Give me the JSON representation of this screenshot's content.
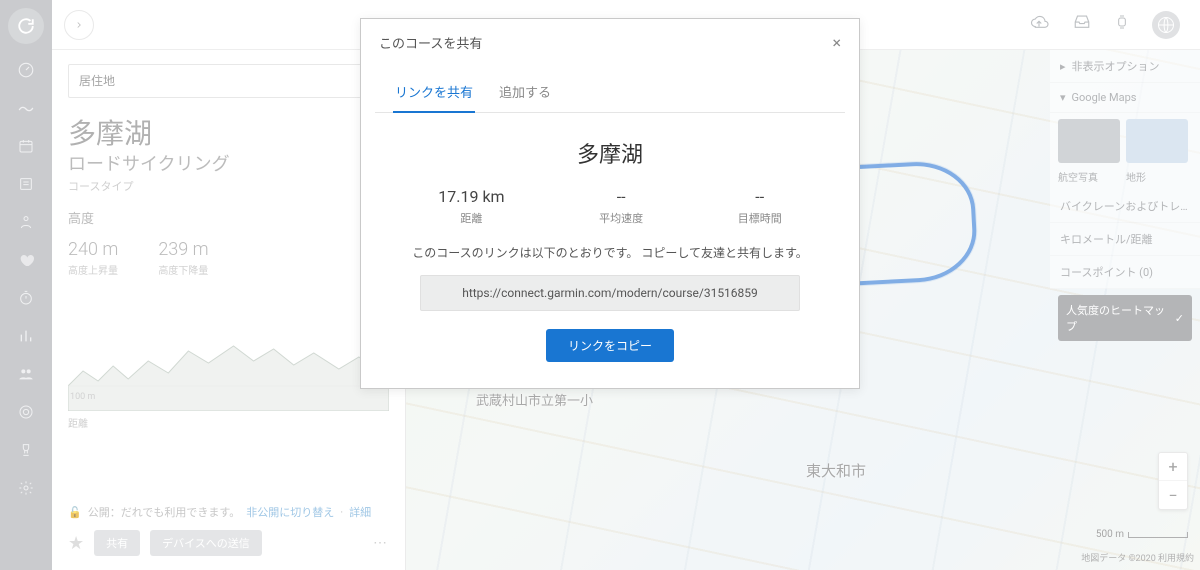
{
  "search": {
    "placeholder": "居住地"
  },
  "course": {
    "title": "多摩湖",
    "type": "ロードサイクリング",
    "type_label": "コースタイプ",
    "elev_section": "高度",
    "ascent": {
      "val": "240 m",
      "lbl": "高度上昇量"
    },
    "descent": {
      "val": "239 m",
      "lbl": "高度下降量"
    },
    "elev_span": "距離",
    "elev_y0": "100 m"
  },
  "privacy": {
    "text": "公開：だれでも利用できます。",
    "private_link": "非公開に切り替え",
    "detail_link": "詳細"
  },
  "actions": {
    "share": "共有",
    "send": "デバイスへの送信"
  },
  "map_opts": {
    "display_options": "非表示オプション",
    "google_maps": "Google Maps",
    "thumb1": "航空写真",
    "thumb2": "地形",
    "bike": "バイクレーンおよびトレ…",
    "km": "キロメートル/距離",
    "coursepoints": "コースポイント    (0)",
    "heatmap": "人気度のヒートマップ"
  },
  "map_labels": {
    "higashi": "東大和市",
    "murayama": "武蔵村山市立第一小"
  },
  "scale": "500 m",
  "attrib": "地図データ ©2020   利用規約",
  "modal": {
    "title": "このコースを共有",
    "tab_link": "リンクを共有",
    "tab_add": "追加する",
    "name": "多摩湖",
    "stats": {
      "dist_val": "17.19 km",
      "dist_lbl": "距離",
      "speed_val": "--",
      "speed_lbl": "平均速度",
      "time_val": "--",
      "time_lbl": "目標時間"
    },
    "desc": "このコースのリンクは以下のとおりです。 コピーして友達と共有します。",
    "link": "https://connect.garmin.com/modern/course/31516859",
    "copy": "リンクをコピー"
  }
}
